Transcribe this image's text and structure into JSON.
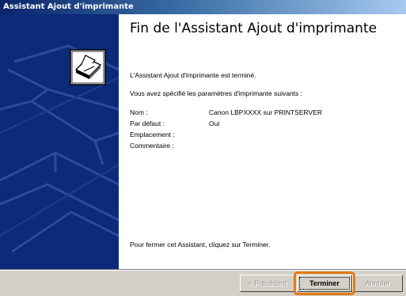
{
  "window": {
    "title": "Assistant Ajout d'imprimante"
  },
  "colors": {
    "side_panel": "#0b2a78",
    "highlight": "#e57a16"
  },
  "heading": "Fin de l'Assistant Ajout d'imprimante",
  "intro": "L'Assistant Ajout d'imprimante est terminé.",
  "params_intro": "Vous avez spécifié les paramètres d'imprimante suivants :",
  "settings": [
    {
      "label": "Nom :",
      "value": "Canon LBPXXXX sur PRINTSERVER"
    },
    {
      "label": "Par défaut :",
      "value": "Oui"
    },
    {
      "label": "Emplacement :",
      "value": ""
    },
    {
      "label": "Commentaire :",
      "value": ""
    }
  ],
  "footer": "Pour fermer cet Assistant, cliquez sur Terminer.",
  "buttons": {
    "back": "< Précédent",
    "finish": "Terminer",
    "cancel": "Annuler"
  },
  "side_icon": "printer-icon"
}
